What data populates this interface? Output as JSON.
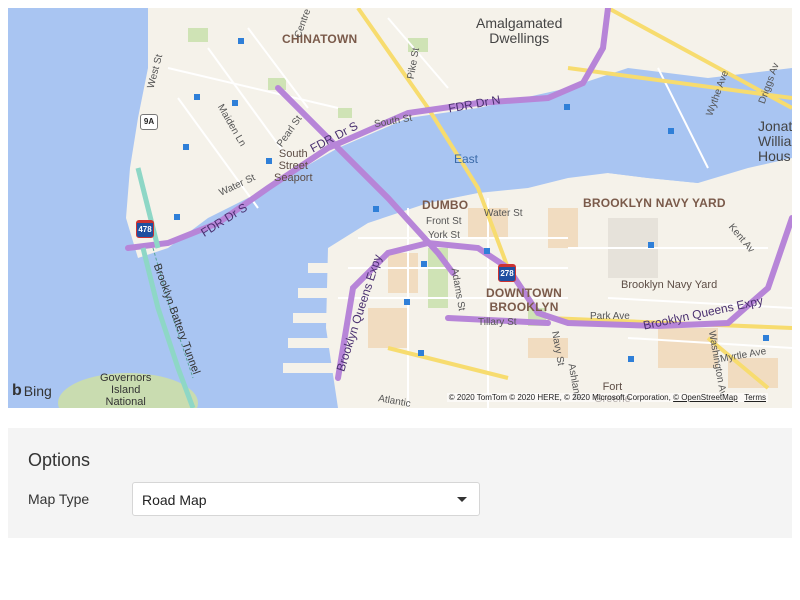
{
  "map": {
    "labels": {
      "chinatown": "CHINATOWN",
      "amalgamated": "Amalgamated\nDwellings",
      "jonat": "Jonat\nWillia\nHous",
      "south_street_seaport": "South\nStreet\nSeaport",
      "east_river": "East",
      "dumbo": "DUMBO",
      "brooklyn_navy_yard_district": "BROOKLYN NAVY YARD",
      "brooklyn_navy_yard": "Brooklyn Navy Yard",
      "downtown_brooklyn": "DOWNTOWN\nBROOKLYN",
      "governors_island": "Governors\nIsland\nNational",
      "fort": "Fort\nGreene",
      "fdr_1": "FDR Dr N",
      "fdr_2": "FDR Dr S",
      "fdr_3": "FDR Dr S",
      "south_st": "South St",
      "water_st_1": "Water St",
      "water_st_2": "Water St",
      "front_st": "Front St",
      "york_st": "York St",
      "pearl_st": "Pearl St",
      "maiden_ln": "Maiden Ln",
      "pike_st": "Pike St",
      "centre": "Centre",
      "west_st": "West St",
      "wythe_ave": "Wythe Ave",
      "driggs_av": "Driggs Av",
      "kent_av": "Kent Av",
      "adams_st": "Adams St",
      "tillary_st": "Tillary St",
      "park_ave": "Park Ave",
      "myrtle_ave": "Myrtle Ave",
      "washington_av": "Washington Av",
      "navy_st": "Navy St",
      "ashland": "Ashland",
      "atlantic": "Atlantic",
      "bqe_1": "Brooklyn Queens Expy",
      "bqe_2": "Brooklyn Queens Expy",
      "battery_tunnel": "Brooklyn Battery Tunnel"
    },
    "shields": {
      "route_9a": "9A",
      "i478": "478",
      "i278": "278"
    },
    "logo": "Bing",
    "attribution": "© 2020 TomTom © 2020 HERE, © 2020 Microsoft Corporation,",
    "attribution_osm": "© OpenStreetMap",
    "attribution_terms": "Terms"
  },
  "options": {
    "title": "Options",
    "map_type_label": "Map Type",
    "map_type_value": "Road Map"
  },
  "colors": {
    "water": "#a9c5f2",
    "land": "#f5f2ea",
    "highway": "#b785d8",
    "panel": "#f4f4f4"
  }
}
